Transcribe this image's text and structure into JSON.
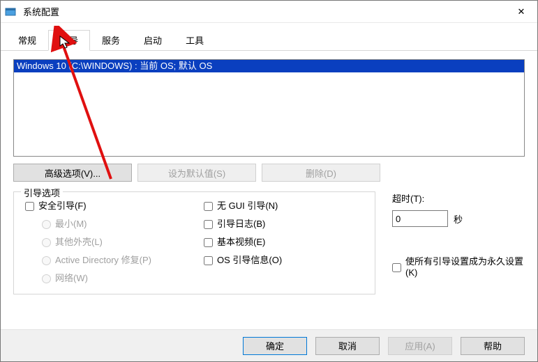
{
  "window": {
    "title": "系统配置",
    "close_glyph": "✕"
  },
  "tabs": {
    "general": "常规",
    "boot": "引导",
    "services": "服务",
    "startup": "启动",
    "tools": "工具"
  },
  "oslist": {
    "entry0": "Windows 10 (C:\\WINDOWS) : 当前 OS; 默认 OS"
  },
  "mid_buttons": {
    "advanced": "高级选项(V)...",
    "set_default": "设为默认值(S)",
    "delete": "删除(D)"
  },
  "boot_options": {
    "legend": "引导选项",
    "safe_boot": "安全引导(F)",
    "minimal": "最小(M)",
    "alt_shell": "其他外壳(L)",
    "ad_repair": "Active Directory 修复(P)",
    "network": "网络(W)",
    "no_gui": "无 GUI 引导(N)",
    "boot_log": "引导日志(B)",
    "base_video": "基本视频(E)",
    "os_boot_info": "OS 引导信息(O)"
  },
  "timeout": {
    "label": "超时(T):",
    "value": "0",
    "unit": "秒"
  },
  "permanent": {
    "label": "使所有引导设置成为永久设置(K)"
  },
  "bottom": {
    "ok": "确定",
    "cancel": "取消",
    "apply": "应用(A)",
    "help": "帮助"
  }
}
